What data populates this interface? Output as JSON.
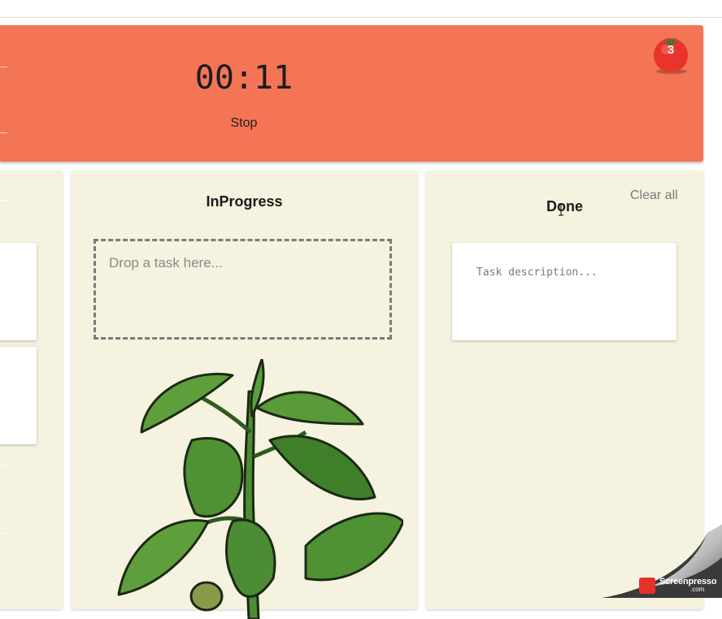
{
  "timer": {
    "display": "00:11",
    "stop_label": "Stop",
    "pomodoro_count": "3",
    "background_color": "#f47456"
  },
  "board": {
    "background_color": "#f5f2df",
    "columns": {
      "todo": {
        "title": ""
      },
      "inprogress": {
        "title": "InProgress",
        "drop_placeholder": "Drop a task here..."
      },
      "done": {
        "title": "Done",
        "clear_all_label": "Clear all",
        "task_placeholder": "Task description..."
      }
    }
  },
  "icons": {
    "tomato": "tomato-icon",
    "plant": "tomato-plant-illustration",
    "cursor": "text-cursor-icon"
  },
  "watermark": {
    "brand": "Screenpresso",
    "domain": ".com"
  }
}
